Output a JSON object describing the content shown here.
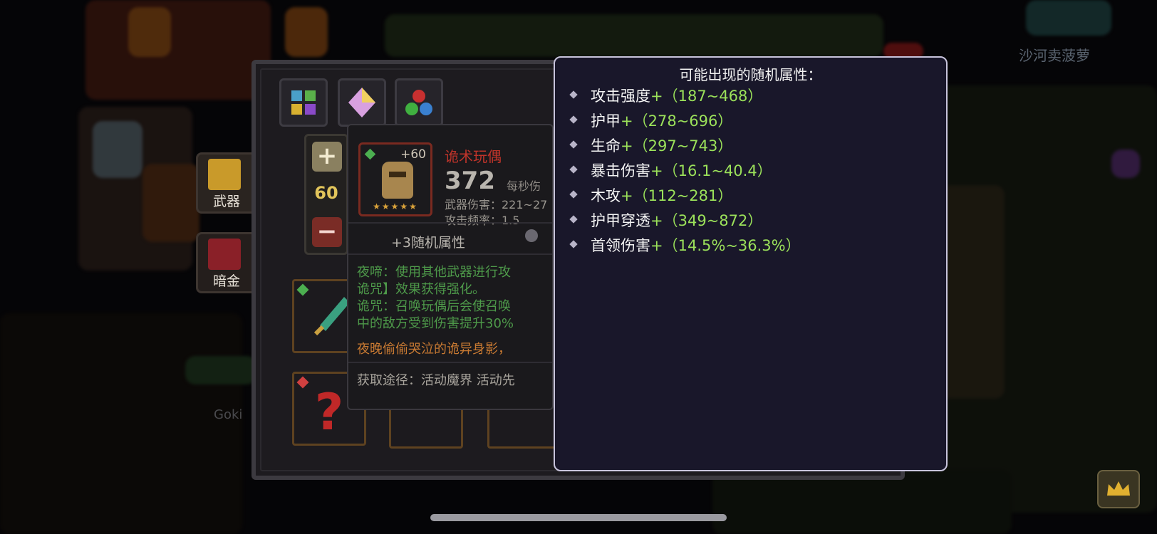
{
  "world": {
    "player_name": "沙河卖菠萝",
    "bottom_tag": "Goki"
  },
  "side_tabs": [
    {
      "label": "武器"
    },
    {
      "label": "暗金"
    }
  ],
  "stepper": {
    "value": "60",
    "plus_label": "+",
    "minus_label": "−"
  },
  "item": {
    "level": "+60",
    "name": "诡术玩偶",
    "power": "372",
    "dps_label": "每秒伤",
    "weapon_damage": "武器伤害：221~27",
    "attack_rate": "攻击频率：1.5",
    "stars": "★★★★★",
    "random_attributes": "+3随机属性",
    "desc_lines": [
      "夜啼：使用其他武器进行攻",
      "诡咒】效果获得强化。",
      "诡咒：召唤玩偶后会使召唤",
      "中的敌方受到伤害提升30%"
    ],
    "lore": "夜晚偷偷哭泣的诡异身影，",
    "source": "获取途径：活动魔界 活动先"
  },
  "tooltip": {
    "title": "可能出现的随机属性：",
    "attributes": [
      {
        "name": "攻击强度",
        "range": "+（187~468）"
      },
      {
        "name": "护甲",
        "range": "+（278~696）"
      },
      {
        "name": "生命",
        "range": "+（297~743）"
      },
      {
        "name": "暴击伤害",
        "range": "+（16.1~40.4）"
      },
      {
        "name": "木攻",
        "range": "+（112~281）"
      },
      {
        "name": "护甲穿透",
        "range": "+（349~872）"
      },
      {
        "name": "首领伤害",
        "range": "+（14.5%~36.3%）"
      }
    ]
  }
}
